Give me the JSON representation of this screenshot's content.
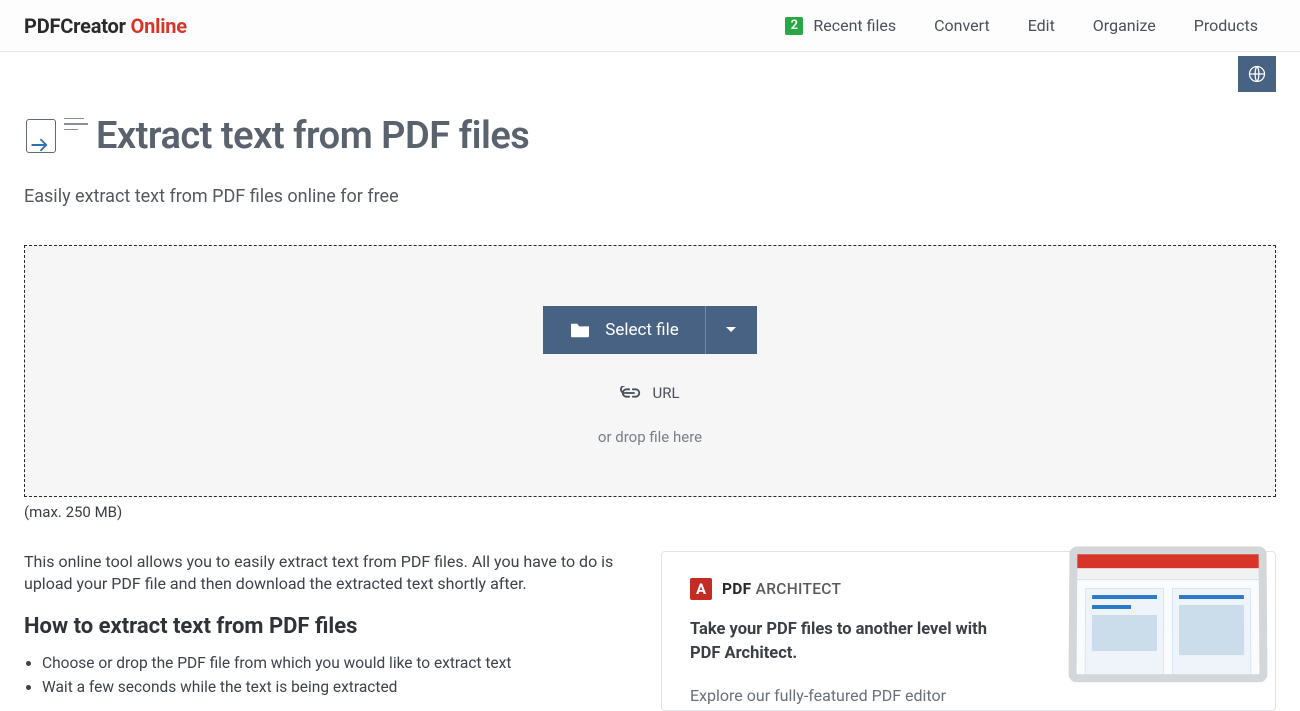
{
  "header": {
    "logo_main": "PDFCreator",
    "logo_accent": "Online",
    "nav": {
      "recent_badge": "2",
      "recent": "Recent files",
      "convert": "Convert",
      "edit": "Edit",
      "organize": "Organize",
      "products": "Products"
    }
  },
  "page": {
    "title": "Extract text from PDF files",
    "subtitle": "Easily extract text from PDF files online for free",
    "select_file": "Select file",
    "url_label": "URL",
    "drop_hint": "or drop file here",
    "max_size": "(max. 250 MB)"
  },
  "desc": {
    "paragraph": "This online tool allows you to easily extract text from PDF files. All you have to do is upload your PDF file and then download the extracted text shortly after.",
    "how_heading": "How to extract text from PDF files",
    "steps": [
      "Choose or drop the PDF file from which you would like to extract text",
      "Wait a few seconds while the text is being extracted"
    ]
  },
  "promo": {
    "logo_letter": "A",
    "logo_brand_bold": "PDF",
    "logo_brand_light": "ARCHITECT",
    "heading": "Take your PDF files to another level with PDF Architect.",
    "sub": "Explore our fully-featured PDF editor"
  }
}
